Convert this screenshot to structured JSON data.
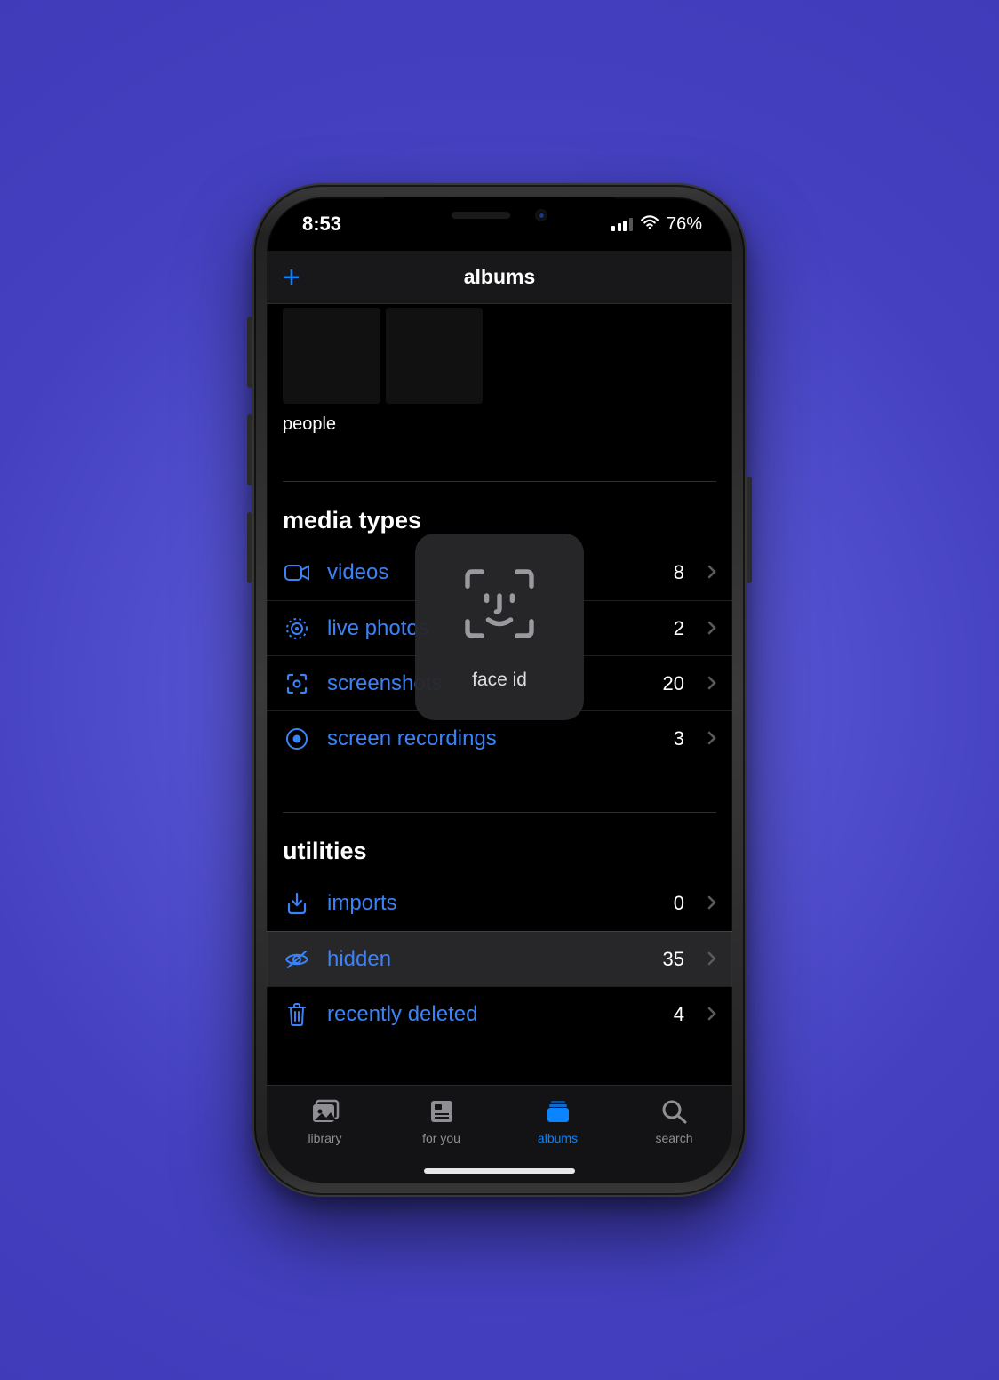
{
  "status": {
    "time": "8:53",
    "battery": "76%"
  },
  "nav": {
    "title": "albums",
    "add_label": "+"
  },
  "people": {
    "label": "people"
  },
  "sections": {
    "media": {
      "title": "media types",
      "items": [
        {
          "icon": "video-icon",
          "label": "videos",
          "count": "8"
        },
        {
          "icon": "live-photo-icon",
          "label": "live photos",
          "count": "2"
        },
        {
          "icon": "screenshot-icon",
          "label": "screenshots",
          "count": "20"
        },
        {
          "icon": "recording-icon",
          "label": "screen recordings",
          "count": "3"
        }
      ]
    },
    "utilities": {
      "title": "utilities",
      "items": [
        {
          "icon": "import-icon",
          "label": "imports",
          "count": "0"
        },
        {
          "icon": "hidden-icon",
          "label": "hidden",
          "count": "35",
          "selected": true
        },
        {
          "icon": "trash-icon",
          "label": "recently deleted",
          "count": "4"
        }
      ]
    }
  },
  "faceid": {
    "label": "face id"
  },
  "tabs": [
    {
      "icon": "library-tab-icon",
      "label": "library"
    },
    {
      "icon": "foryou-tab-icon",
      "label": "for you"
    },
    {
      "icon": "albums-tab-icon",
      "label": "albums",
      "active": true
    },
    {
      "icon": "search-tab-icon",
      "label": "search"
    }
  ]
}
